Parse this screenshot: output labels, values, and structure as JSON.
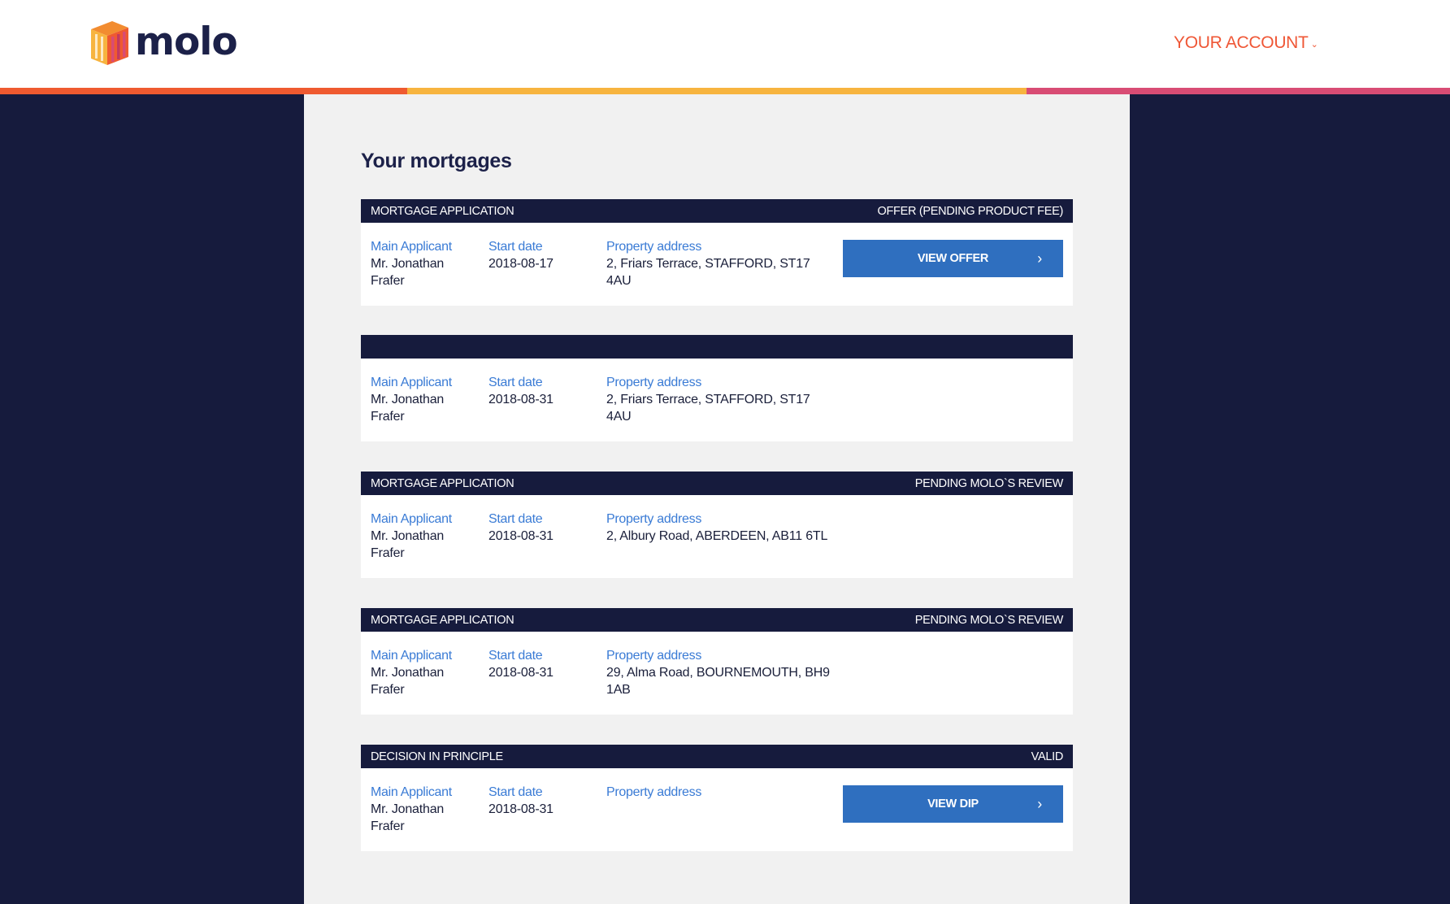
{
  "brand": {
    "name": "molo"
  },
  "header": {
    "account_label": "YOUR ACCOUNT",
    "account_caret": "⌄"
  },
  "page": {
    "title": "Your mortgages"
  },
  "labels": {
    "applicant": "Main Applicant",
    "start_date": "Start date",
    "address": "Property address"
  },
  "cards": [
    {
      "type": "MORTGAGE APPLICATION",
      "status": "OFFER (PENDING PRODUCT FEE)",
      "applicant": "Mr. Jonathan Frafer",
      "start_date": "2018-08-17",
      "address": "2, Friars Terrace, STAFFORD, ST17 4AU",
      "action": "VIEW OFFER"
    },
    {
      "type": "",
      "status": "",
      "applicant": "Mr. Jonathan Frafer",
      "start_date": "2018-08-31",
      "address": "2, Friars Terrace, STAFFORD, ST17 4AU"
    },
    {
      "type": "MORTGAGE APPLICATION",
      "status": "PENDING MOLO`S REVIEW",
      "applicant": "Mr. Jonathan Frafer",
      "start_date": "2018-08-31",
      "address": "2, Albury Road, ABERDEEN, AB11 6TL"
    },
    {
      "type": "MORTGAGE APPLICATION",
      "status": "PENDING MOLO`S REVIEW",
      "applicant": "Mr. Jonathan Frafer",
      "start_date": "2018-08-31",
      "address": "29, Alma Road, BOURNEMOUTH, BH9 1AB"
    },
    {
      "type": "DECISION IN PRINCIPLE",
      "status": "VALID",
      "applicant": "Mr. Jonathan Frafer",
      "start_date": "2018-08-31",
      "address": "",
      "action": "VIEW DIP"
    }
  ],
  "icons": {
    "logo": "molo-logo-icon",
    "button_arrow": "chevron-right-icon",
    "account_caret": "chevron-down-icon"
  },
  "colors": {
    "navy": "#161b3d",
    "accent_orange": "#ef5736",
    "stripe_orange": "#ef5a30",
    "stripe_yellow": "#f7b43f",
    "stripe_pink": "#d84c74",
    "button_blue": "#2f6fbf",
    "label_blue": "#3a7bd5"
  }
}
